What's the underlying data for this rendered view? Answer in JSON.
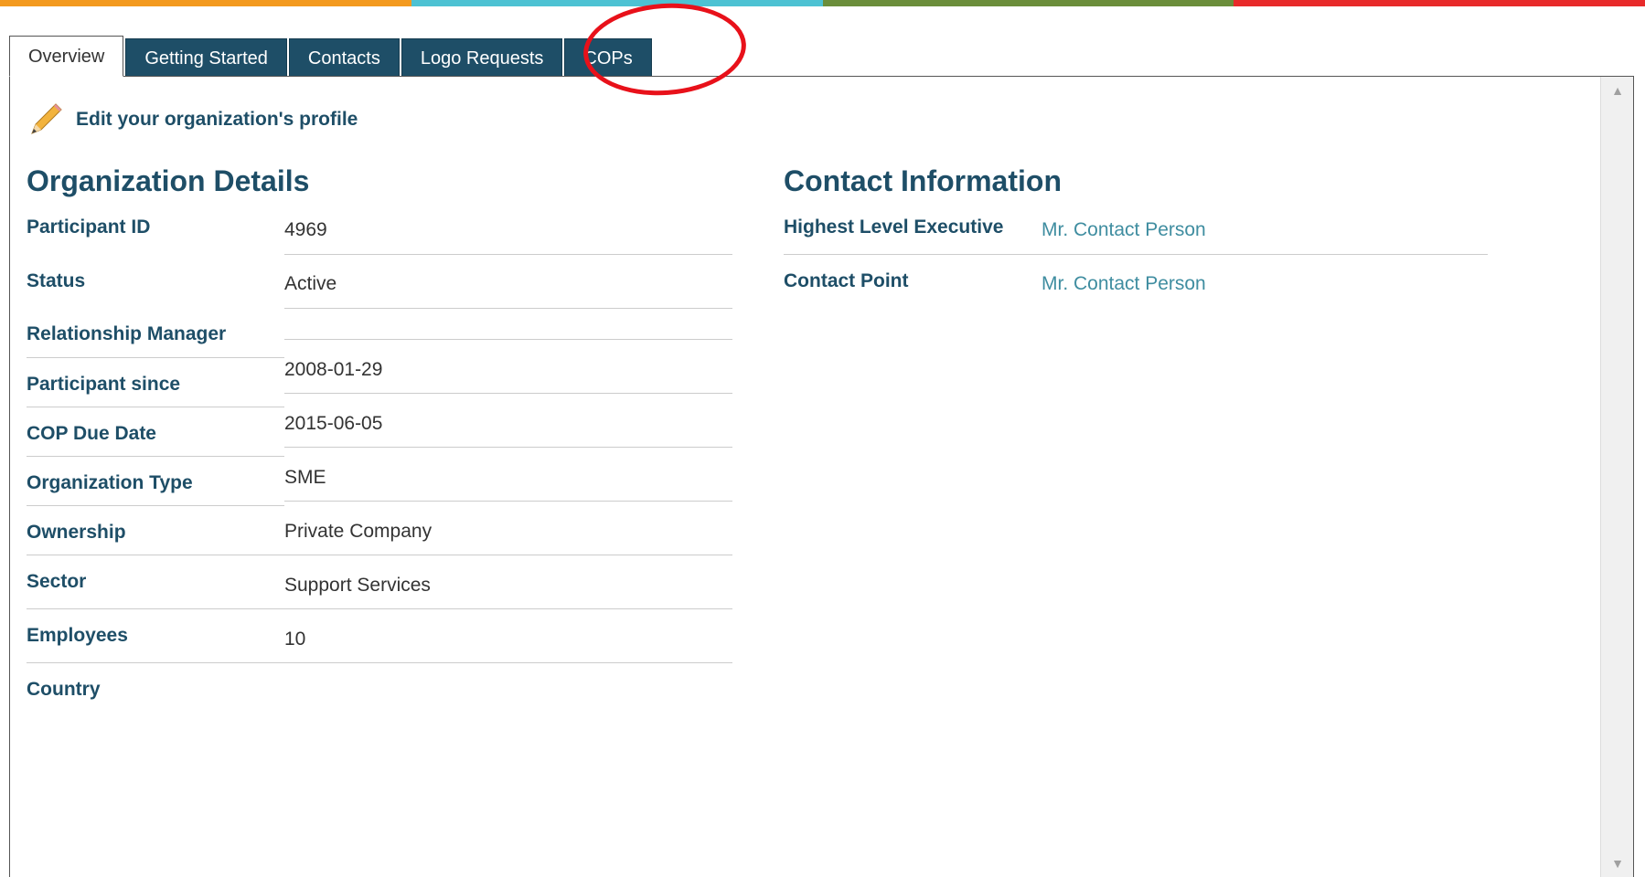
{
  "colors": {
    "bar": [
      "#f39a1f",
      "#4dc2d3",
      "#6b8e3b",
      "#e82a2a"
    ],
    "accent": "#1e4e67",
    "link": "#3f8da0",
    "annotation": "#e8111a"
  },
  "tabs": [
    {
      "label": "Overview"
    },
    {
      "label": "Getting Started"
    },
    {
      "label": "Contacts"
    },
    {
      "label": "Logo Requests"
    },
    {
      "label": "COPs"
    }
  ],
  "edit_link": {
    "label": "Edit your organization's profile",
    "icon": "pencil-icon"
  },
  "org_details": {
    "title": "Organization Details",
    "rows": [
      {
        "label": "Participant ID",
        "value": "4969"
      },
      {
        "label": "Status",
        "value": "Active"
      },
      {
        "label": "Relationship Manager",
        "value": ""
      },
      {
        "label": "Participant since",
        "value": "2008-01-29"
      },
      {
        "label": "COP Due Date",
        "value": "2015-06-05"
      },
      {
        "label": "Organization Type",
        "value": "SME"
      },
      {
        "label": "Ownership",
        "value": "Private Company"
      },
      {
        "label": "Sector",
        "value": "Support Services"
      },
      {
        "label": "Employees",
        "value": "10"
      },
      {
        "label": "Country",
        "value": ""
      }
    ]
  },
  "contact_info": {
    "title": "Contact Information",
    "rows": [
      {
        "label": "Highest Level Executive",
        "value": "Mr. Contact Person"
      },
      {
        "label": "Contact Point",
        "value": "Mr. Contact Person"
      }
    ]
  }
}
